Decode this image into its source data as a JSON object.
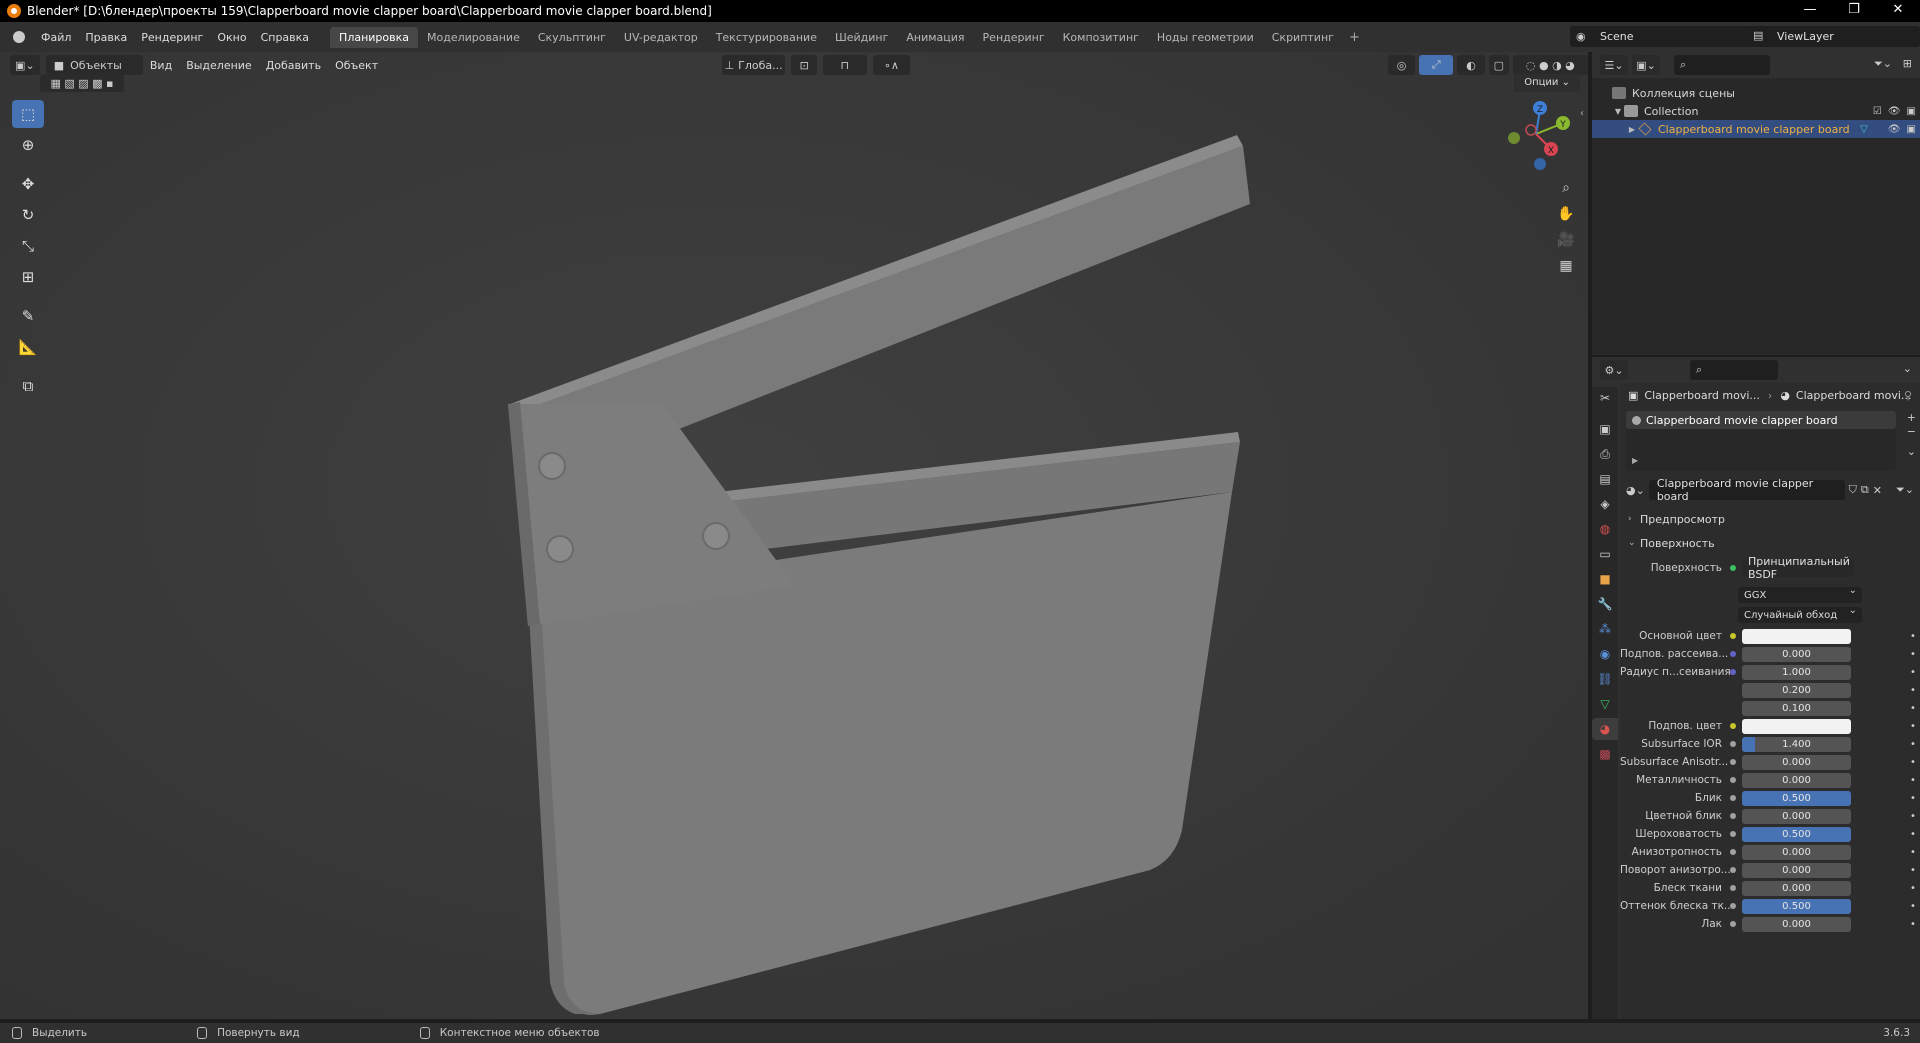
{
  "window": {
    "title": "Blender* [D:\\блендер\\проекты 159\\Clapperboard movie clapper board\\Clapperboard movie clapper board.blend]",
    "controls": [
      "—",
      "❐",
      "✕"
    ]
  },
  "menubar": {
    "menus": [
      "Файл",
      "Правка",
      "Рендеринг",
      "Окно",
      "Справка"
    ],
    "workspaces": [
      "Планировка",
      "Моделирование",
      "Скульптинг",
      "UV-редактор",
      "Текстурирование",
      "Шейдинг",
      "Анимация",
      "Рендеринг",
      "Композитинг",
      "Ноды геометрии",
      "Скриптинг"
    ],
    "active_workspace": 0,
    "add_tab": "+",
    "scene": "Scene",
    "view_layer": "ViewLayer"
  },
  "viewport": {
    "mode": "Объекты",
    "menus": [
      "Вид",
      "Выделение",
      "Добавить",
      "Объект"
    ],
    "orientation": "Глоба...",
    "options": "Опции",
    "gizmo_axes": [
      "X",
      "Y",
      "Z"
    ]
  },
  "outliner": {
    "rows": [
      {
        "label": "Коллекция сцены",
        "level": 0
      },
      {
        "label": "Collection",
        "level": 1
      },
      {
        "label": "Clapperboard movie clapper board",
        "level": 2,
        "active": true
      }
    ]
  },
  "properties": {
    "breadcrumb": [
      "Clapperboard movi...",
      "Clapperboard movi..."
    ],
    "material_slot": "Clapperboard movie clapper board",
    "material_name": "Clapperboard movie clapper board",
    "panels": {
      "preview": "Предпросмотр",
      "surface": "Поверхность"
    },
    "surface_label": "Поверхность",
    "surface_shader": "Принципиальный BSDF",
    "distribution": "GGX",
    "subsurface_method": "Случайный обход",
    "fields": [
      {
        "label": "Основной цвет",
        "value": "",
        "type": "color",
        "dot": "#c7c729"
      },
      {
        "label": "Подпов. рассеива...",
        "value": "0.000",
        "dot": "#6363c7",
        "fill": 0
      },
      {
        "label": "Радиус п...сеивания",
        "value": "1.000",
        "dot": "#6363c7",
        "fill": 0
      },
      {
        "label": "",
        "value": "0.200",
        "fill": 0
      },
      {
        "label": "",
        "value": "0.100",
        "fill": 0
      },
      {
        "label": "Подпов. цвет",
        "value": "",
        "type": "color",
        "dot": "#c7c729"
      },
      {
        "label": "Subsurface IOR",
        "value": "1.400",
        "dot": "#a1a1a1",
        "fill": 0.12
      },
      {
        "label": "Subsurface Anisotr...",
        "value": "0.000",
        "dot": "#a1a1a1",
        "fill": 0
      },
      {
        "label": "Металличность",
        "value": "0.000",
        "dot": "#a1a1a1",
        "fill": 0
      },
      {
        "label": "Блик",
        "value": "0.500",
        "dot": "#a1a1a1",
        "fill": 1
      },
      {
        "label": "Цветной блик",
        "value": "0.000",
        "dot": "#a1a1a1",
        "fill": 0
      },
      {
        "label": "Шероховатость",
        "value": "0.500",
        "dot": "#a1a1a1",
        "fill": 1
      },
      {
        "label": "Анизотропность",
        "value": "0.000",
        "dot": "#a1a1a1",
        "fill": 0
      },
      {
        "label": "Поворот анизотро...",
        "value": "0.000",
        "dot": "#a1a1a1",
        "fill": 0
      },
      {
        "label": "Блеск ткани",
        "value": "0.000",
        "dot": "#a1a1a1",
        "fill": 0
      },
      {
        "label": "Оттенок блеска тк...",
        "value": "0.500",
        "dot": "#a1a1a1",
        "fill": 1
      },
      {
        "label": "Лак",
        "value": "0.000",
        "dot": "#a1a1a1",
        "fill": 0
      }
    ]
  },
  "statusbar": {
    "select": "Выделить",
    "rotate": "Повернуть вид",
    "context": "Контекстное меню объектов",
    "version": "3.6.3"
  }
}
